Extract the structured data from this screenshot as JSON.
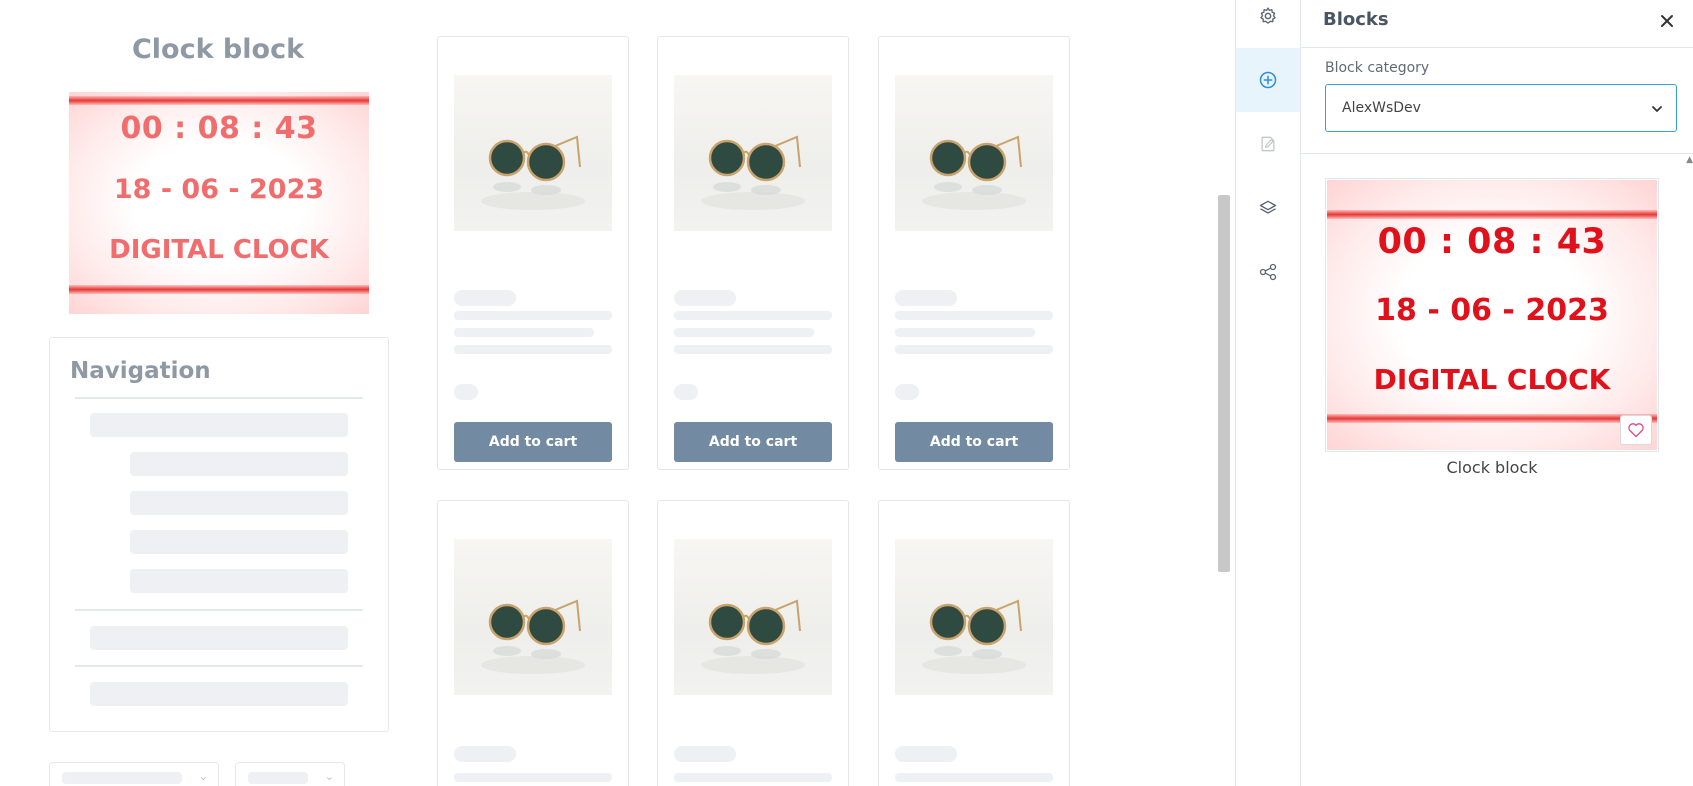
{
  "canvas": {
    "clock_block": {
      "title": "Clock block",
      "time": "00 : 08 : 43",
      "date": "18 - 06 - 2023",
      "label": "DIGITAL CLOCK"
    },
    "navigation": {
      "title": "Navigation"
    },
    "products": {
      "add_to_cart_label": "Add to cart"
    }
  },
  "toolbar": {
    "icons": [
      "gear-icon",
      "plus-circle-icon",
      "edit-icon",
      "layers-icon",
      "share-icon"
    ],
    "active": "plus-circle-icon"
  },
  "blocks_panel": {
    "title": "Blocks",
    "category_label": "Block category",
    "category_value": "AlexWsDev",
    "block": {
      "name": "Clock block",
      "preview_time": "00 : 08 : 43",
      "preview_date": "18 - 06 - 2023",
      "preview_label": "DIGITAL CLOCK"
    }
  },
  "colors": {
    "accent": "#3a9fd8",
    "button": "#728aa2",
    "clock_red": "#e0111b",
    "clock_pink": "#f16d6d"
  }
}
